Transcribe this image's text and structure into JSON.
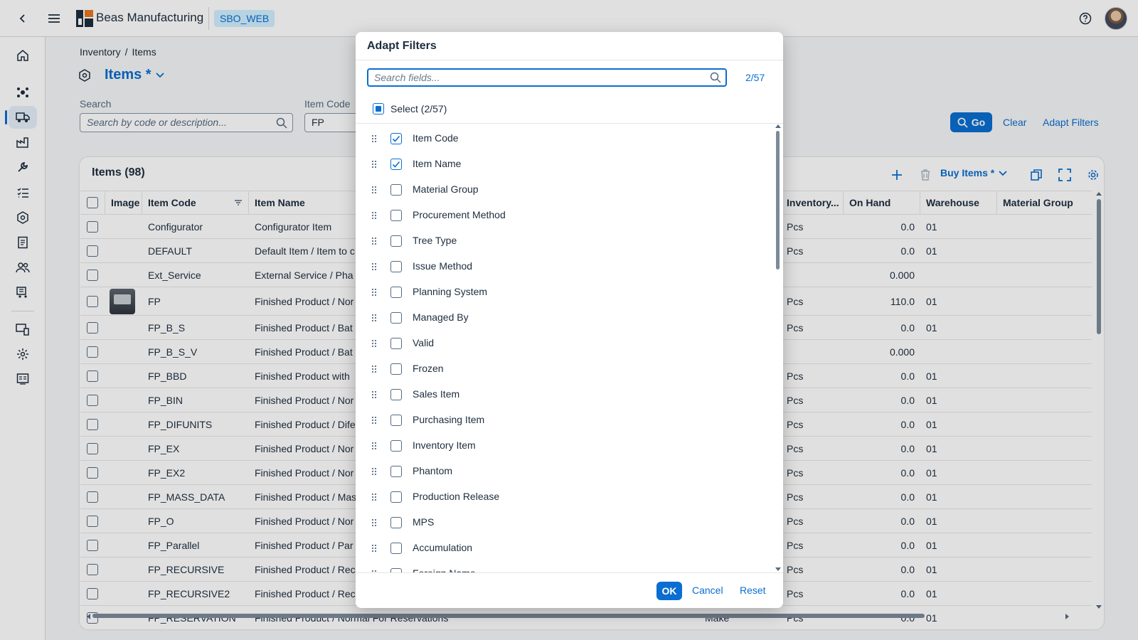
{
  "shell": {
    "app_title": "Beas Manufacturing",
    "system_tag": "SBO_WEB"
  },
  "breadcrumb": [
    "Inventory",
    "/",
    "Items"
  ],
  "page": {
    "title": "Items *"
  },
  "filterbar": {
    "search_label": "Search",
    "search_placeholder": "Search by code or description...",
    "item_code_label": "Item Code",
    "item_code_value": "FP",
    "go_label": "Go",
    "clear_label": "Clear",
    "adapt_label": "Adapt Filters"
  },
  "table": {
    "title": "Items (98)",
    "variant": "Buy Items *",
    "columns_left": [
      "Image",
      "Item Code",
      "Item Name"
    ],
    "columns_right": [
      "Inventory...",
      "On Hand",
      "Warehouse",
      "Material Group"
    ],
    "rows": [
      {
        "code": "Configurator",
        "name": "Configurator Item",
        "uom": "Pcs",
        "onhand": "0.0",
        "wh": "01",
        "img": false
      },
      {
        "code": "DEFAULT",
        "name": "Default Item / Item to c",
        "uom": "Pcs",
        "onhand": "0.0",
        "wh": "01",
        "img": false
      },
      {
        "code": "Ext_Service",
        "name": "External Service / Pha",
        "uom": "",
        "onhand": "0.000",
        "wh": "",
        "img": false
      },
      {
        "code": "FP",
        "name": "Finished Product / Nor",
        "uom": "Pcs",
        "onhand": "110.0",
        "wh": "01",
        "img": true
      },
      {
        "code": "FP_B_S",
        "name": "Finished Product / Bat",
        "uom": "Pcs",
        "onhand": "0.0",
        "wh": "01",
        "img": false
      },
      {
        "code": "FP_B_S_V",
        "name": "Finished Product / Bat",
        "uom": "",
        "onhand": "0.000",
        "wh": "",
        "img": false
      },
      {
        "code": "FP_BBD",
        "name": "Finished Product with",
        "uom": "Pcs",
        "onhand": "0.0",
        "wh": "01",
        "img": false
      },
      {
        "code": "FP_BIN",
        "name": "Finished Product / Nor",
        "uom": "Pcs",
        "onhand": "0.0",
        "wh": "01",
        "img": false
      },
      {
        "code": "FP_DIFUNITS",
        "name": "Finished Product / Dife",
        "uom": "Pcs",
        "onhand": "0.0",
        "wh": "01",
        "img": false
      },
      {
        "code": "FP_EX",
        "name": "Finished Product / Nor",
        "uom": "Pcs",
        "onhand": "0.0",
        "wh": "01",
        "img": false
      },
      {
        "code": "FP_EX2",
        "name": "Finished Product / Nor",
        "uom": "Pcs",
        "onhand": "0.0",
        "wh": "01",
        "img": false
      },
      {
        "code": "FP_MASS_DATA",
        "name": "Finished Product / Mas",
        "uom": "Pcs",
        "onhand": "0.0",
        "wh": "01",
        "img": false
      },
      {
        "code": "FP_O",
        "name": "Finished Product / Nor",
        "uom": "Pcs",
        "onhand": "0.0",
        "wh": "01",
        "img": false
      },
      {
        "code": "FP_Parallel",
        "name": "Finished Product / Par",
        "uom": "Pcs",
        "onhand": "0.0",
        "wh": "01",
        "img": false
      },
      {
        "code": "FP_RECURSIVE",
        "name": "Finished Product / Rec",
        "uom": "Pcs",
        "onhand": "0.0",
        "wh": "01",
        "img": false
      },
      {
        "code": "FP_RECURSIVE2",
        "name": "Finished Product / Rec",
        "uom": "Pcs",
        "onhand": "0.0",
        "wh": "01",
        "img": false
      },
      {
        "code": "FP_RESERVATION",
        "name": "Finished Product / Normal For Reservations",
        "uom": "Pcs",
        "onhand": "0.0",
        "wh": "01",
        "img": false,
        "extra": "Make"
      }
    ]
  },
  "dialog": {
    "title": "Adapt Filters",
    "search_placeholder": "Search fields...",
    "count": "2/57",
    "select_all": "Select (2/57)",
    "fields": [
      {
        "label": "Item Code",
        "checked": true
      },
      {
        "label": "Item Name",
        "checked": true
      },
      {
        "label": "Material Group",
        "checked": false
      },
      {
        "label": "Procurement Method",
        "checked": false
      },
      {
        "label": "Tree Type",
        "checked": false
      },
      {
        "label": "Issue Method",
        "checked": false
      },
      {
        "label": "Planning System",
        "checked": false
      },
      {
        "label": "Managed By",
        "checked": false
      },
      {
        "label": "Valid",
        "checked": false
      },
      {
        "label": "Frozen",
        "checked": false
      },
      {
        "label": "Sales Item",
        "checked": false
      },
      {
        "label": "Purchasing Item",
        "checked": false
      },
      {
        "label": "Inventory Item",
        "checked": false
      },
      {
        "label": "Phantom",
        "checked": false
      },
      {
        "label": "Production Release",
        "checked": false
      },
      {
        "label": "MPS",
        "checked": false
      },
      {
        "label": "Accumulation",
        "checked": false
      },
      {
        "label": "Foreign Name",
        "checked": false
      }
    ],
    "ok_label": "OK",
    "cancel_label": "Cancel",
    "reset_label": "Reset"
  },
  "colors": {
    "accent": "#0a6ed1",
    "text": "#1d2d3e",
    "shell_bg": "#ffffff",
    "page_bg": "#f5f6f7"
  }
}
